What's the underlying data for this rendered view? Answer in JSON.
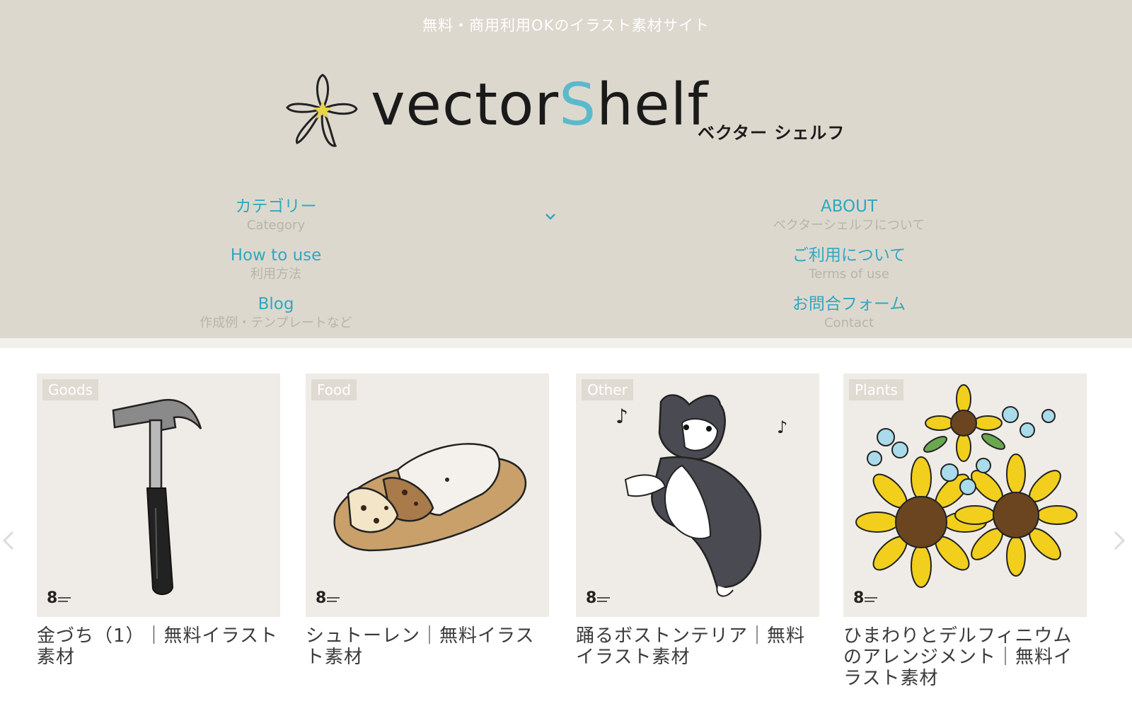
{
  "header": {
    "tagline": "無料・商用利用OKのイラスト素材サイト",
    "logo": {
      "text_a": "vector",
      "text_accent": "S",
      "text_b": "helf",
      "kana": "ベクター シェルフ",
      "accent_color": "#5bb9cc",
      "star_color": "#e8d44a"
    },
    "background_color": "#ddd8ce"
  },
  "nav": {
    "left": [
      {
        "label": "カテゴリー",
        "sub": "Category"
      },
      {
        "label": "How to use",
        "sub": "利用方法"
      },
      {
        "label": "Blog",
        "sub": "作成例・テンプレートなど"
      }
    ],
    "right": [
      {
        "label": "ABOUT",
        "sub": "ベクターシェルフについて"
      },
      {
        "label": "ご利用について",
        "sub": "Terms of use"
      },
      {
        "label": "お問合フォーム",
        "sub": "Contact"
      }
    ],
    "toggle_icon": "chevron-down-icon",
    "link_color": "#2fa8be"
  },
  "cards": [
    {
      "category": "Goods",
      "title": "金づち（1）｜無料イラスト素材",
      "image": "hammer"
    },
    {
      "category": "Food",
      "title": "シュトーレン｜無料イラスト素材",
      "image": "stollen"
    },
    {
      "category": "Other",
      "title": "踊るボストンテリア｜無料イラスト素材",
      "image": "boston-terrier"
    },
    {
      "category": "Plants",
      "title": "ひまわりとデルフィニウムのアレンジメント｜無料イラスト素材",
      "image": "sunflower-delphinium"
    }
  ],
  "carousel": {
    "prev_icon": "chevron-left-icon",
    "next_icon": "chevron-right-icon"
  }
}
